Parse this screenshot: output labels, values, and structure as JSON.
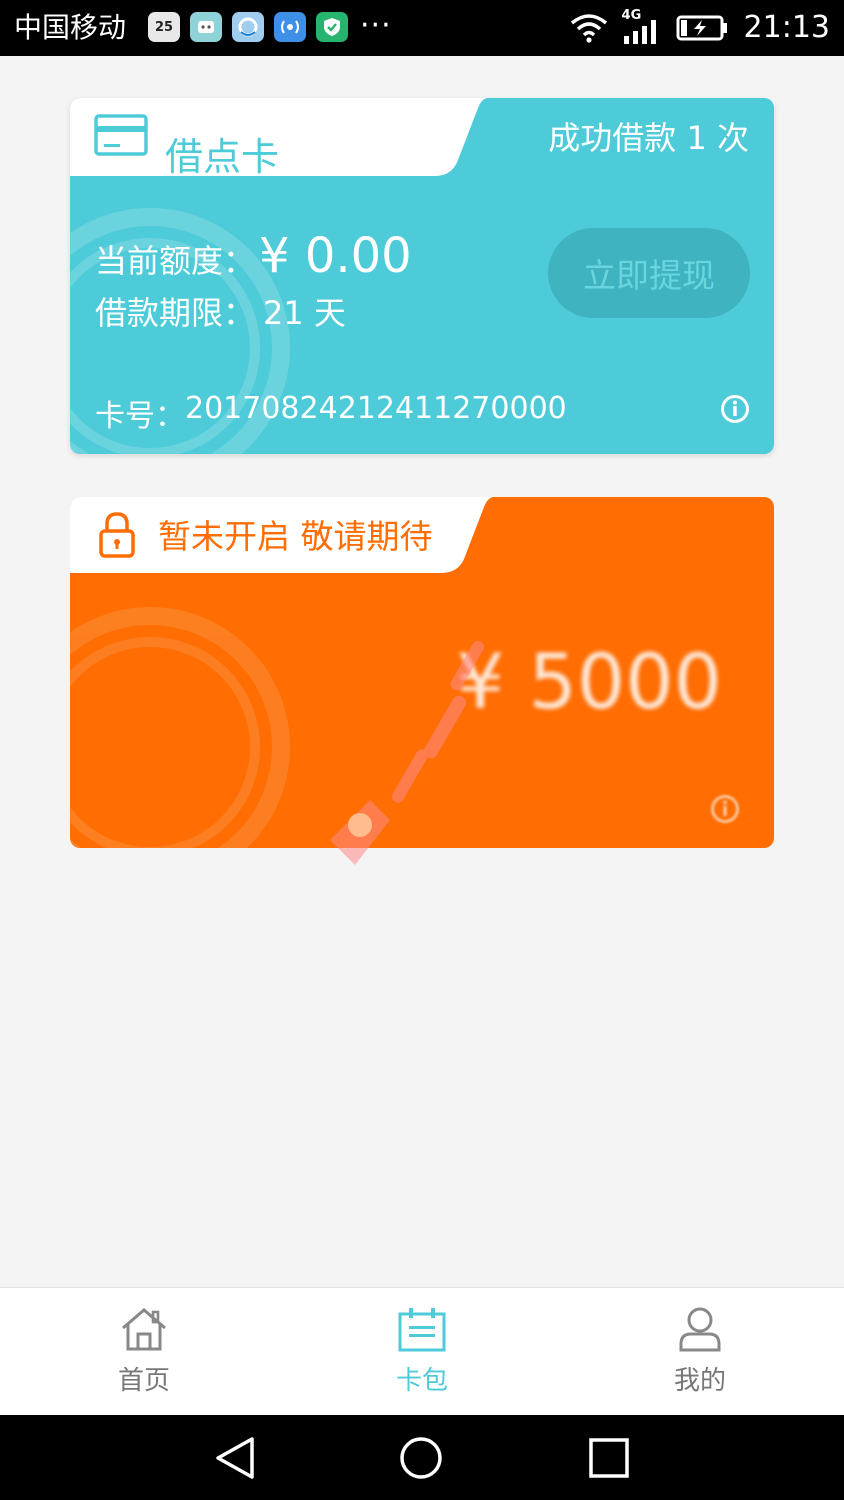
{
  "status_bar": {
    "carrier": "中国移动",
    "calendar_day": "25",
    "network": "4G",
    "time": "21:13"
  },
  "loan_card": {
    "title": "借点卡",
    "success_count": "成功借款 1 次",
    "quota_label": "当前额度：",
    "quota_value": "¥ 0.00",
    "term_label": "借款期限：",
    "term_value": "21 天",
    "card_no_label": "卡号：",
    "card_no_value": "20170824212411270000",
    "withdraw_label": "立即提现",
    "color": "#4ecbd8"
  },
  "locked_card": {
    "title": "暂未开启 敬请期待",
    "amount": "¥ 5000",
    "color": "#ff6d03"
  },
  "bottom_nav": {
    "items": [
      {
        "label": "首页",
        "icon": "home-icon",
        "active": false
      },
      {
        "label": "卡包",
        "icon": "card-wallet-icon",
        "active": true
      },
      {
        "label": "我的",
        "icon": "profile-icon",
        "active": false
      }
    ],
    "active_color": "#4ecbd8"
  },
  "system_nav": {
    "icons": [
      "back-icon",
      "home-circle-icon",
      "recents-icon"
    ]
  }
}
